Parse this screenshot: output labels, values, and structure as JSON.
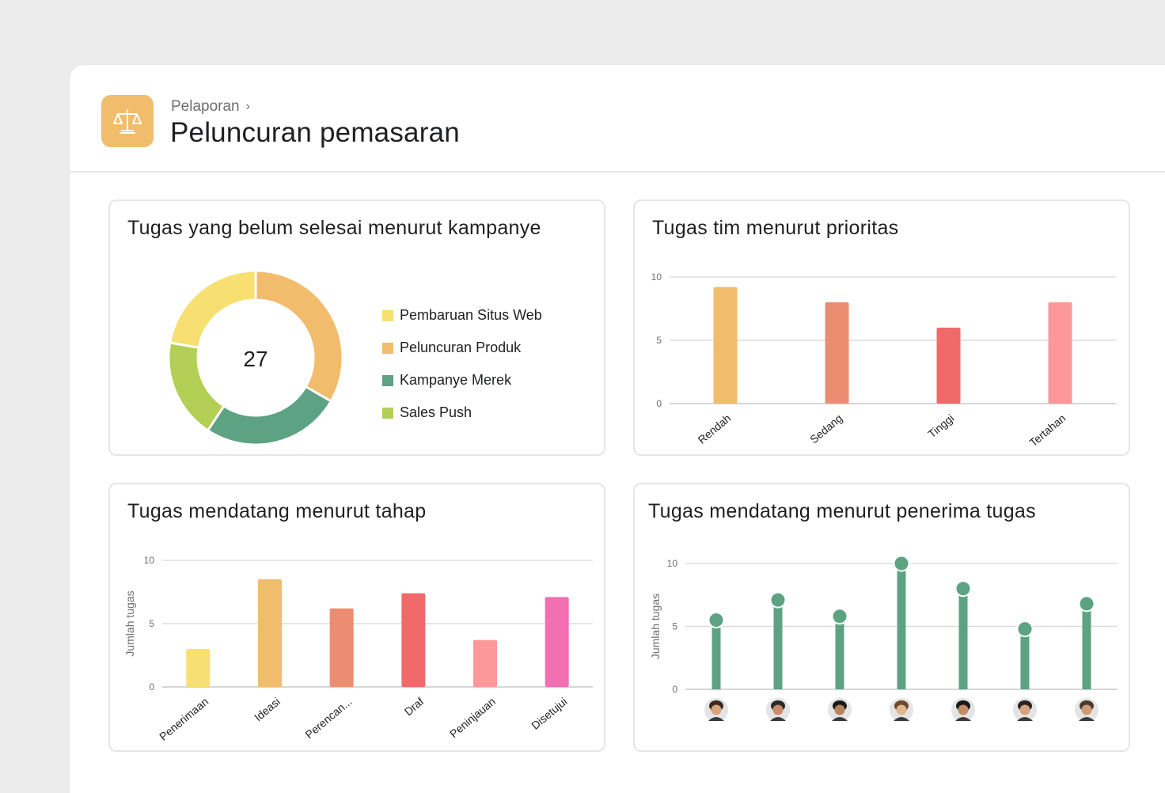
{
  "breadcrumb": {
    "parent": "Pelaporan",
    "chevron": "›"
  },
  "page_title": "Peluncuran pemasaran",
  "app_icon": {
    "name": "scale-icon",
    "color": "#f1bd6c"
  },
  "cards": {
    "campaign": {
      "title": "Tugas yang belum selesai menurut kampanye",
      "total": "27"
    },
    "priority": {
      "title": "Tugas tim menurut prioritas"
    },
    "stage": {
      "title": "Tugas mendatang menurut tahap"
    },
    "assignee": {
      "title": "Tugas mendatang menurut penerima tugas"
    }
  },
  "chart_data": [
    {
      "type": "pie",
      "title": "Tugas yang belum selesai menurut kampanye",
      "center_label": "27",
      "categories": [
        "Pembaruan Situs Web",
        "Peluncuran Produk",
        "Kampanye Merek",
        "Sales Push"
      ],
      "values": [
        6,
        9,
        7,
        5
      ],
      "colors": [
        "#f8df72",
        "#f1bd6c",
        "#5da283",
        "#b3cf55"
      ],
      "legend": "right"
    },
    {
      "type": "bar",
      "title": "Tugas tim menurut prioritas",
      "categories": [
        "Rendah",
        "Sedang",
        "Tinggi",
        "Tertahan"
      ],
      "values": [
        9.2,
        8,
        6,
        8
      ],
      "colors": [
        "#f1bd6c",
        "#ec8d71",
        "#f06a6a",
        "#fc979a"
      ],
      "ylim": [
        0,
        10
      ],
      "yticks": [
        "0",
        "5",
        "10"
      ],
      "grid": true
    },
    {
      "type": "bar",
      "title": "Tugas mendatang menurut tahap",
      "ylabel": "Jumlah tugas",
      "categories": [
        "Penerimaan",
        "Ideasi",
        "Perencan...",
        "Draf",
        "Peninjauan",
        "Disetujui"
      ],
      "values": [
        3,
        8.5,
        6.2,
        7.4,
        3.7,
        7.1
      ],
      "colors": [
        "#f8df72",
        "#f1bd6c",
        "#ec8d71",
        "#f06a6a",
        "#fc979a",
        "#f26fb2"
      ],
      "ylim": [
        0,
        10
      ],
      "yticks": [
        "0",
        "5",
        "10"
      ],
      "grid": true
    },
    {
      "type": "bar",
      "title": "Tugas mendatang menurut penerima tugas",
      "ylabel": "Jumlah tugas",
      "categories": [
        "avatar-1",
        "avatar-2",
        "avatar-3",
        "avatar-4",
        "avatar-5",
        "avatar-6",
        "avatar-7"
      ],
      "values": [
        5.5,
        7.1,
        5.8,
        10,
        8,
        4.8,
        6.8
      ],
      "color": "#5da283",
      "ylim": [
        0,
        10
      ],
      "yticks": [
        "0",
        "5",
        "10"
      ],
      "grid": true
    }
  ]
}
